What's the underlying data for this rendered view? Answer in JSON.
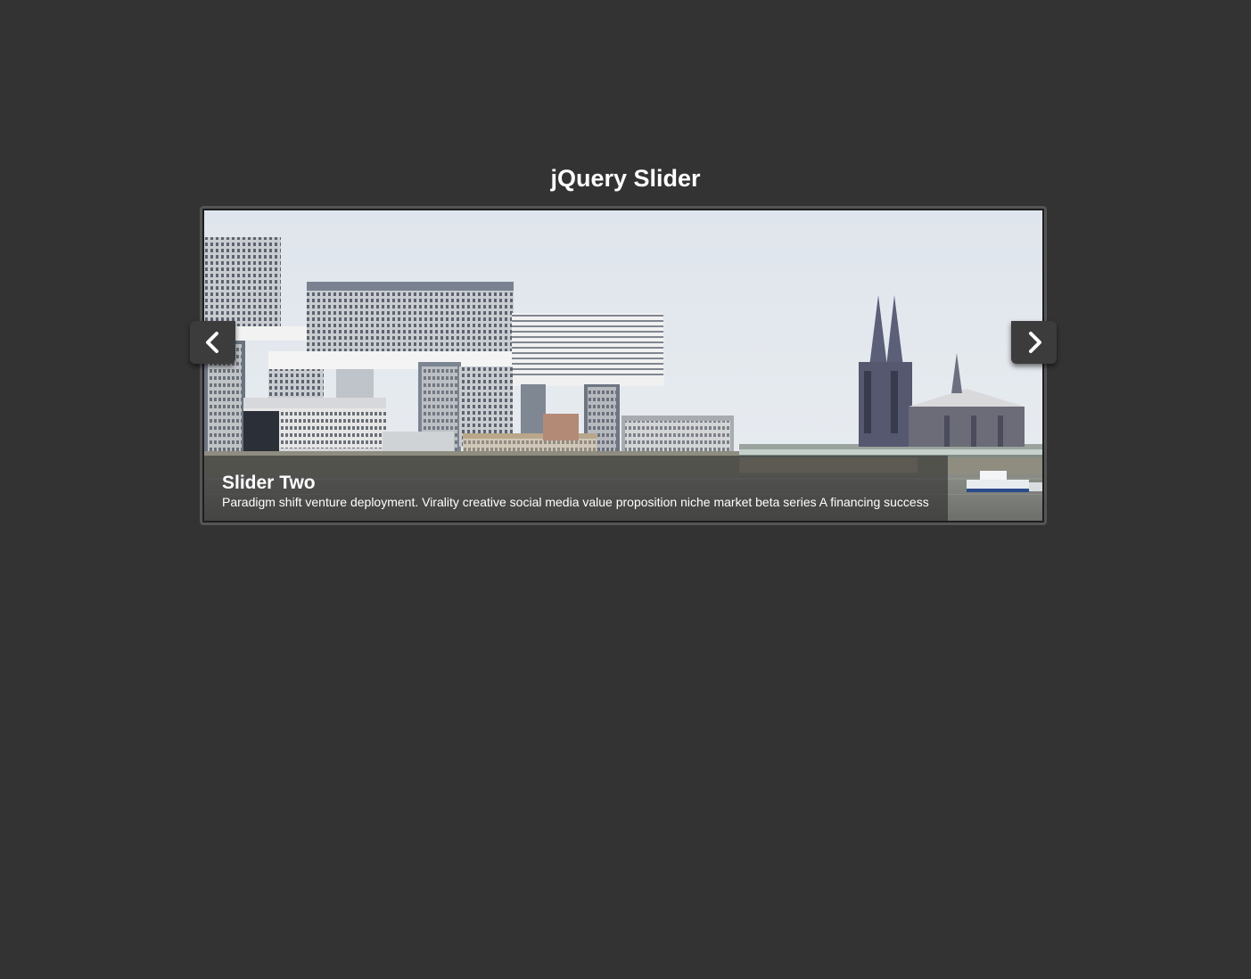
{
  "page": {
    "title": "jQuery Slider"
  },
  "slider": {
    "current_slide": {
      "title": "Slider Two",
      "description": "Paradigm shift venture deployment. Virality creative social media value proposition niche market beta series A financing success",
      "image_subject": "city skyline with crane houses and cathedral by a river"
    },
    "prev_icon": "chevron-left-icon",
    "next_icon": "chevron-right-icon"
  },
  "colors": {
    "background": "#333333",
    "frame_border": "#555555",
    "button_bg": "#3c3c3c",
    "text": "#ffffff"
  }
}
